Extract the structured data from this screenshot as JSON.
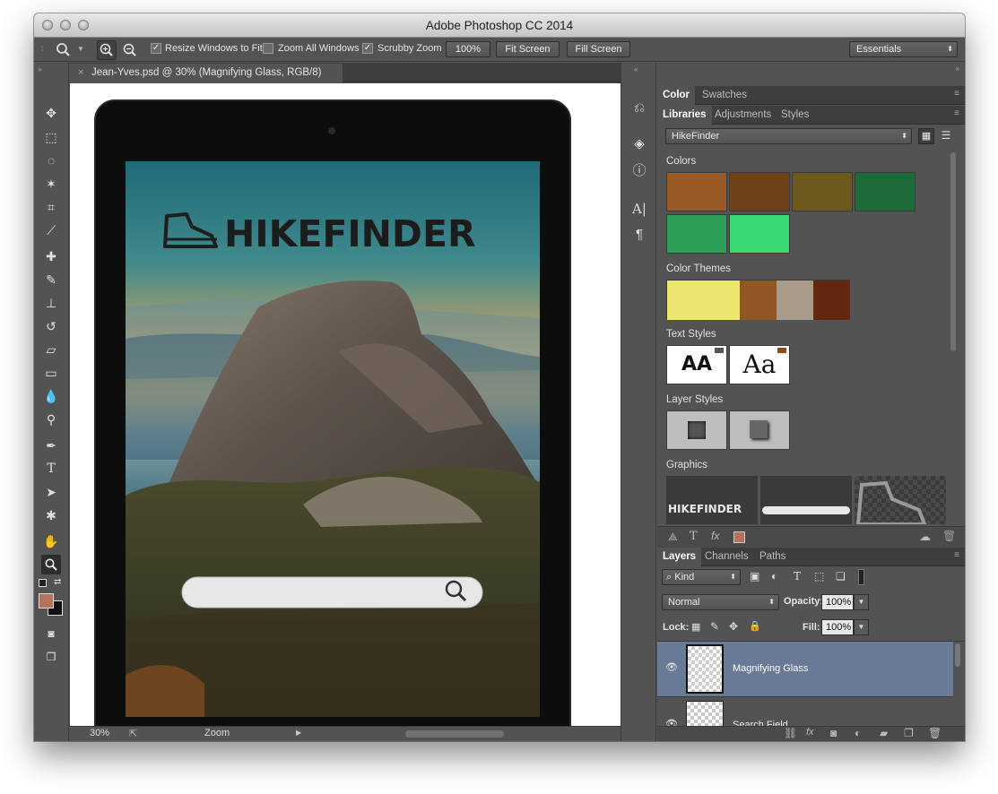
{
  "window": {
    "title": "Adobe Photoshop CC 2014"
  },
  "options_bar": {
    "resize_windows_label": "Resize Windows to Fit",
    "zoom_all_label": "Zoom All Windows",
    "scrubby_zoom_label": "Scrubby Zoom",
    "zoom_pct_label": "100%",
    "fit_screen_label": "Fit Screen",
    "fill_screen_label": "Fill Screen",
    "workspace_label": "Essentials"
  },
  "document": {
    "tab_title": "Jean-Yves.psd @ 30% (Magnifying Glass, RGB/8)",
    "logo_text": "HIKEFINDER"
  },
  "status_bar": {
    "zoom_value": "30%",
    "tool_label": "Zoom"
  },
  "color_panel": {
    "tabs": [
      "Color",
      "Swatches"
    ]
  },
  "libraries_panel": {
    "tabs": [
      "Libraries",
      "Adjustments",
      "Styles"
    ],
    "library_name": "HikeFinder",
    "colors_label": "Colors",
    "colors": [
      "#9a5a26",
      "#6e4219",
      "#6b5a1c",
      "#1d6a3a",
      "#2aa058",
      "#38d873"
    ],
    "color_themes_label": "Color Themes",
    "color_theme": [
      "#ece570",
      "#8e5724",
      "#a89b8c",
      "#62290f"
    ],
    "text_styles_label": "Text Styles",
    "text_styles": [
      {
        "sample": "AA"
      },
      {
        "sample": "Aa"
      }
    ],
    "layer_styles_label": "Layer Styles",
    "graphics_label": "Graphics",
    "graphics_logo_text": "HIKEFINDER"
  },
  "layers_panel": {
    "tabs": [
      "Layers",
      "Channels",
      "Paths"
    ],
    "filter_label": "Kind",
    "blend_mode": "Normal",
    "opacity_label": "Opacity:",
    "opacity_value": "100%",
    "lock_label": "Lock:",
    "fill_label": "Fill:",
    "fill_value": "100%",
    "layers": [
      {
        "name": "Magnifying Glass",
        "selected": true
      },
      {
        "name": "Search Field",
        "selected": false
      }
    ]
  }
}
